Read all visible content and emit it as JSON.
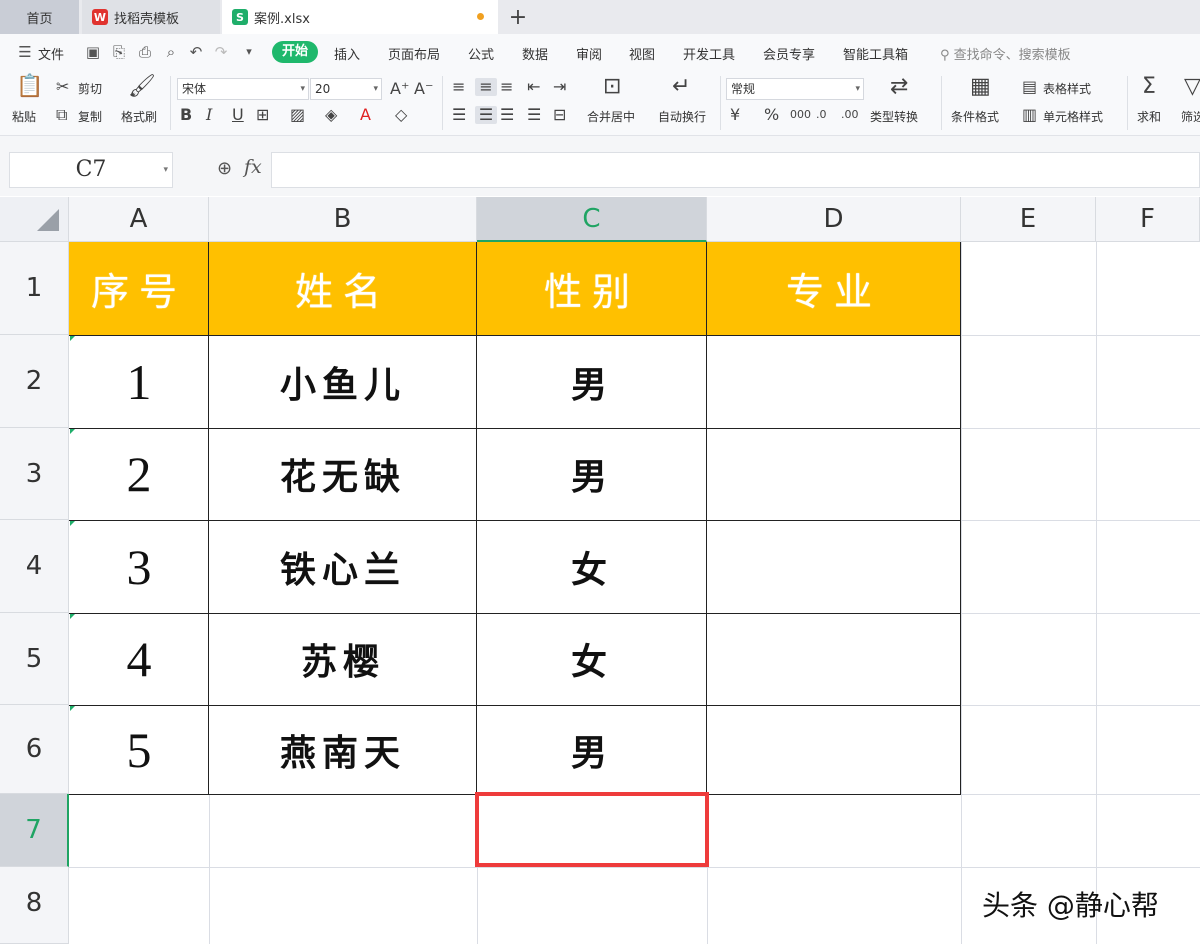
{
  "tabs": {
    "home": "首页",
    "template": "找稻壳模板",
    "file": "案例.xlsx",
    "add": "+"
  },
  "menu": {
    "file": "文件",
    "items": [
      "开始",
      "插入",
      "页面布局",
      "公式",
      "数据",
      "审阅",
      "视图",
      "开发工具",
      "会员专享",
      "智能工具箱"
    ],
    "search_placeholder": "查找命令、搜索模板"
  },
  "ribbon": {
    "paste": "粘贴",
    "cut": "剪切",
    "copy": "复制",
    "format_painter": "格式刷",
    "font_name": "宋体",
    "font_size": "20",
    "bold": "B",
    "italic": "I",
    "underline": "U",
    "merge_center": "合并居中",
    "wrap_text": "自动换行",
    "number_format": "常规",
    "type_convert": "类型转换",
    "conditional_format": "条件格式",
    "table_style": "表格样式",
    "cell_style": "单元格样式",
    "sum": "求和",
    "filter": "筛选"
  },
  "formula_bar": {
    "name_box": "C7",
    "fx": "fx",
    "formula": ""
  },
  "grid": {
    "columns": [
      "A",
      "B",
      "C",
      "D",
      "E",
      "F"
    ],
    "rows": [
      "1",
      "2",
      "3",
      "4",
      "5",
      "6",
      "7",
      "8"
    ],
    "selected_cell": "C7",
    "header": [
      "序号",
      "姓名",
      "性别",
      "专业"
    ],
    "data": [
      [
        "1",
        "小鱼儿",
        "男",
        ""
      ],
      [
        "2",
        "花无缺",
        "男",
        ""
      ],
      [
        "3",
        "铁心兰",
        "女",
        ""
      ],
      [
        "4",
        "苏樱",
        "女",
        ""
      ],
      [
        "5",
        "燕南天",
        "男",
        ""
      ]
    ]
  },
  "colors": {
    "header_fill": "#ffc000",
    "accent_green": "#1fae6a",
    "highlight_red": "#ee3b3b"
  },
  "watermark": "头条 @静心帮"
}
